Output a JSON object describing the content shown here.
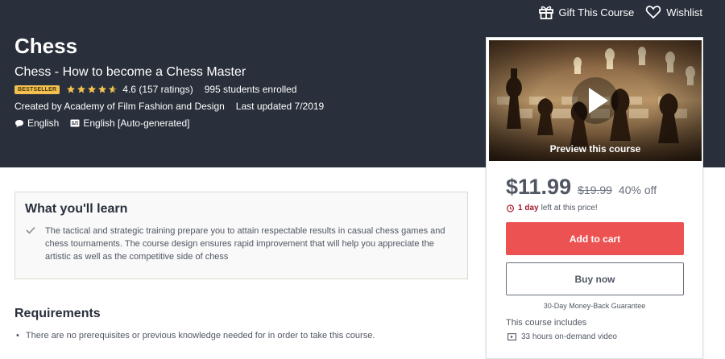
{
  "header": {
    "gift_label": "Gift This Course",
    "wishlist_label": "Wishlist",
    "title": "Chess",
    "subtitle": "Chess - How to become a Chess Master",
    "badge": "BESTSELLER",
    "rating": "4.6",
    "rating_count": "(157 ratings)",
    "stars_filled": 4.6,
    "students": "995 students enrolled",
    "created_by": "Created by Academy of Film Fashion and Design",
    "last_updated": "Last updated 7/2019",
    "language": "English",
    "captions": "English [Auto-generated]"
  },
  "card": {
    "preview_label": "Preview this course",
    "price": "$11.99",
    "original_price": "$19.99",
    "discount": "40% off",
    "countdown_days": "1 day",
    "countdown_rest": "left at this price!",
    "add_to_cart": "Add to cart",
    "buy_now": "Buy now",
    "guarantee": "30-Day Money-Back Guarantee",
    "includes_title": "This course includes",
    "includes_items": [
      "33 hours on-demand video"
    ]
  },
  "learn": {
    "heading": "What you'll learn",
    "items": [
      "The tactical and strategic training prepare you to attain respectable results in casual chess games and chess tournaments. The course design ensures rapid improvement that will help you appreciate the artistic as well as the competitive side of chess"
    ]
  },
  "requirements": {
    "heading": "Requirements",
    "items": [
      "There are no prerequisites or previous knowledge needed for in order to take this course."
    ]
  },
  "colors": {
    "header_bg": "#29303b",
    "cart_button": "#ec5252",
    "badge": "#f4c150",
    "star": "#f4c150",
    "urgency": "#a31b2a"
  },
  "icons": [
    "gift-icon",
    "heart-icon",
    "star-icon",
    "speech-bubble-icon",
    "captions-icon",
    "alarm-clock-icon",
    "check-icon",
    "video-icon",
    "play-icon"
  ]
}
